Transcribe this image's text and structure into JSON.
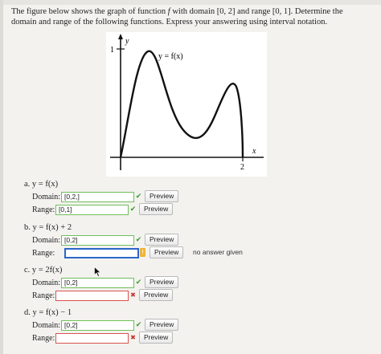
{
  "question": {
    "intro": "The figure below shows the graph of function ",
    "fname": "f",
    "mid1": " with domain ",
    "domain": "[0, 2]",
    "mid2": " and range ",
    "range": "[0, 1]",
    "rest": ". Determine the domain and range of the following functions. Express your answering using interval notation."
  },
  "graph": {
    "y_axis_label": "y",
    "x_axis_label": "x",
    "y_tick_label": "1",
    "x_tick_label": "2",
    "curve_label": "y = f(x)"
  },
  "labels": {
    "domain": "Domain:",
    "range": "Range:",
    "preview": "Preview",
    "no_answer": "no answer given"
  },
  "parts": [
    {
      "title": "a. y = f(x)",
      "domain_value": "[0,2,]",
      "range_value": "[0,1]"
    },
    {
      "title": "b. y = f(x) + 2",
      "domain_value": "[0,2]",
      "range_value": ""
    },
    {
      "title": "c. y = 2f(x)",
      "domain_value": "[0,2]",
      "range_value": ""
    },
    {
      "title": "d. y = f(x) − 1",
      "domain_value": "[0,2]",
      "range_value": ""
    }
  ],
  "colors": {
    "correct": "#3c9a33",
    "incorrect": "#c9302c",
    "warning": "#f2b233",
    "active_border": "#2a66c9"
  },
  "icons": [
    "checkmark-icon",
    "cross-icon",
    "warning-icon",
    "mouse-cursor-icon"
  ]
}
